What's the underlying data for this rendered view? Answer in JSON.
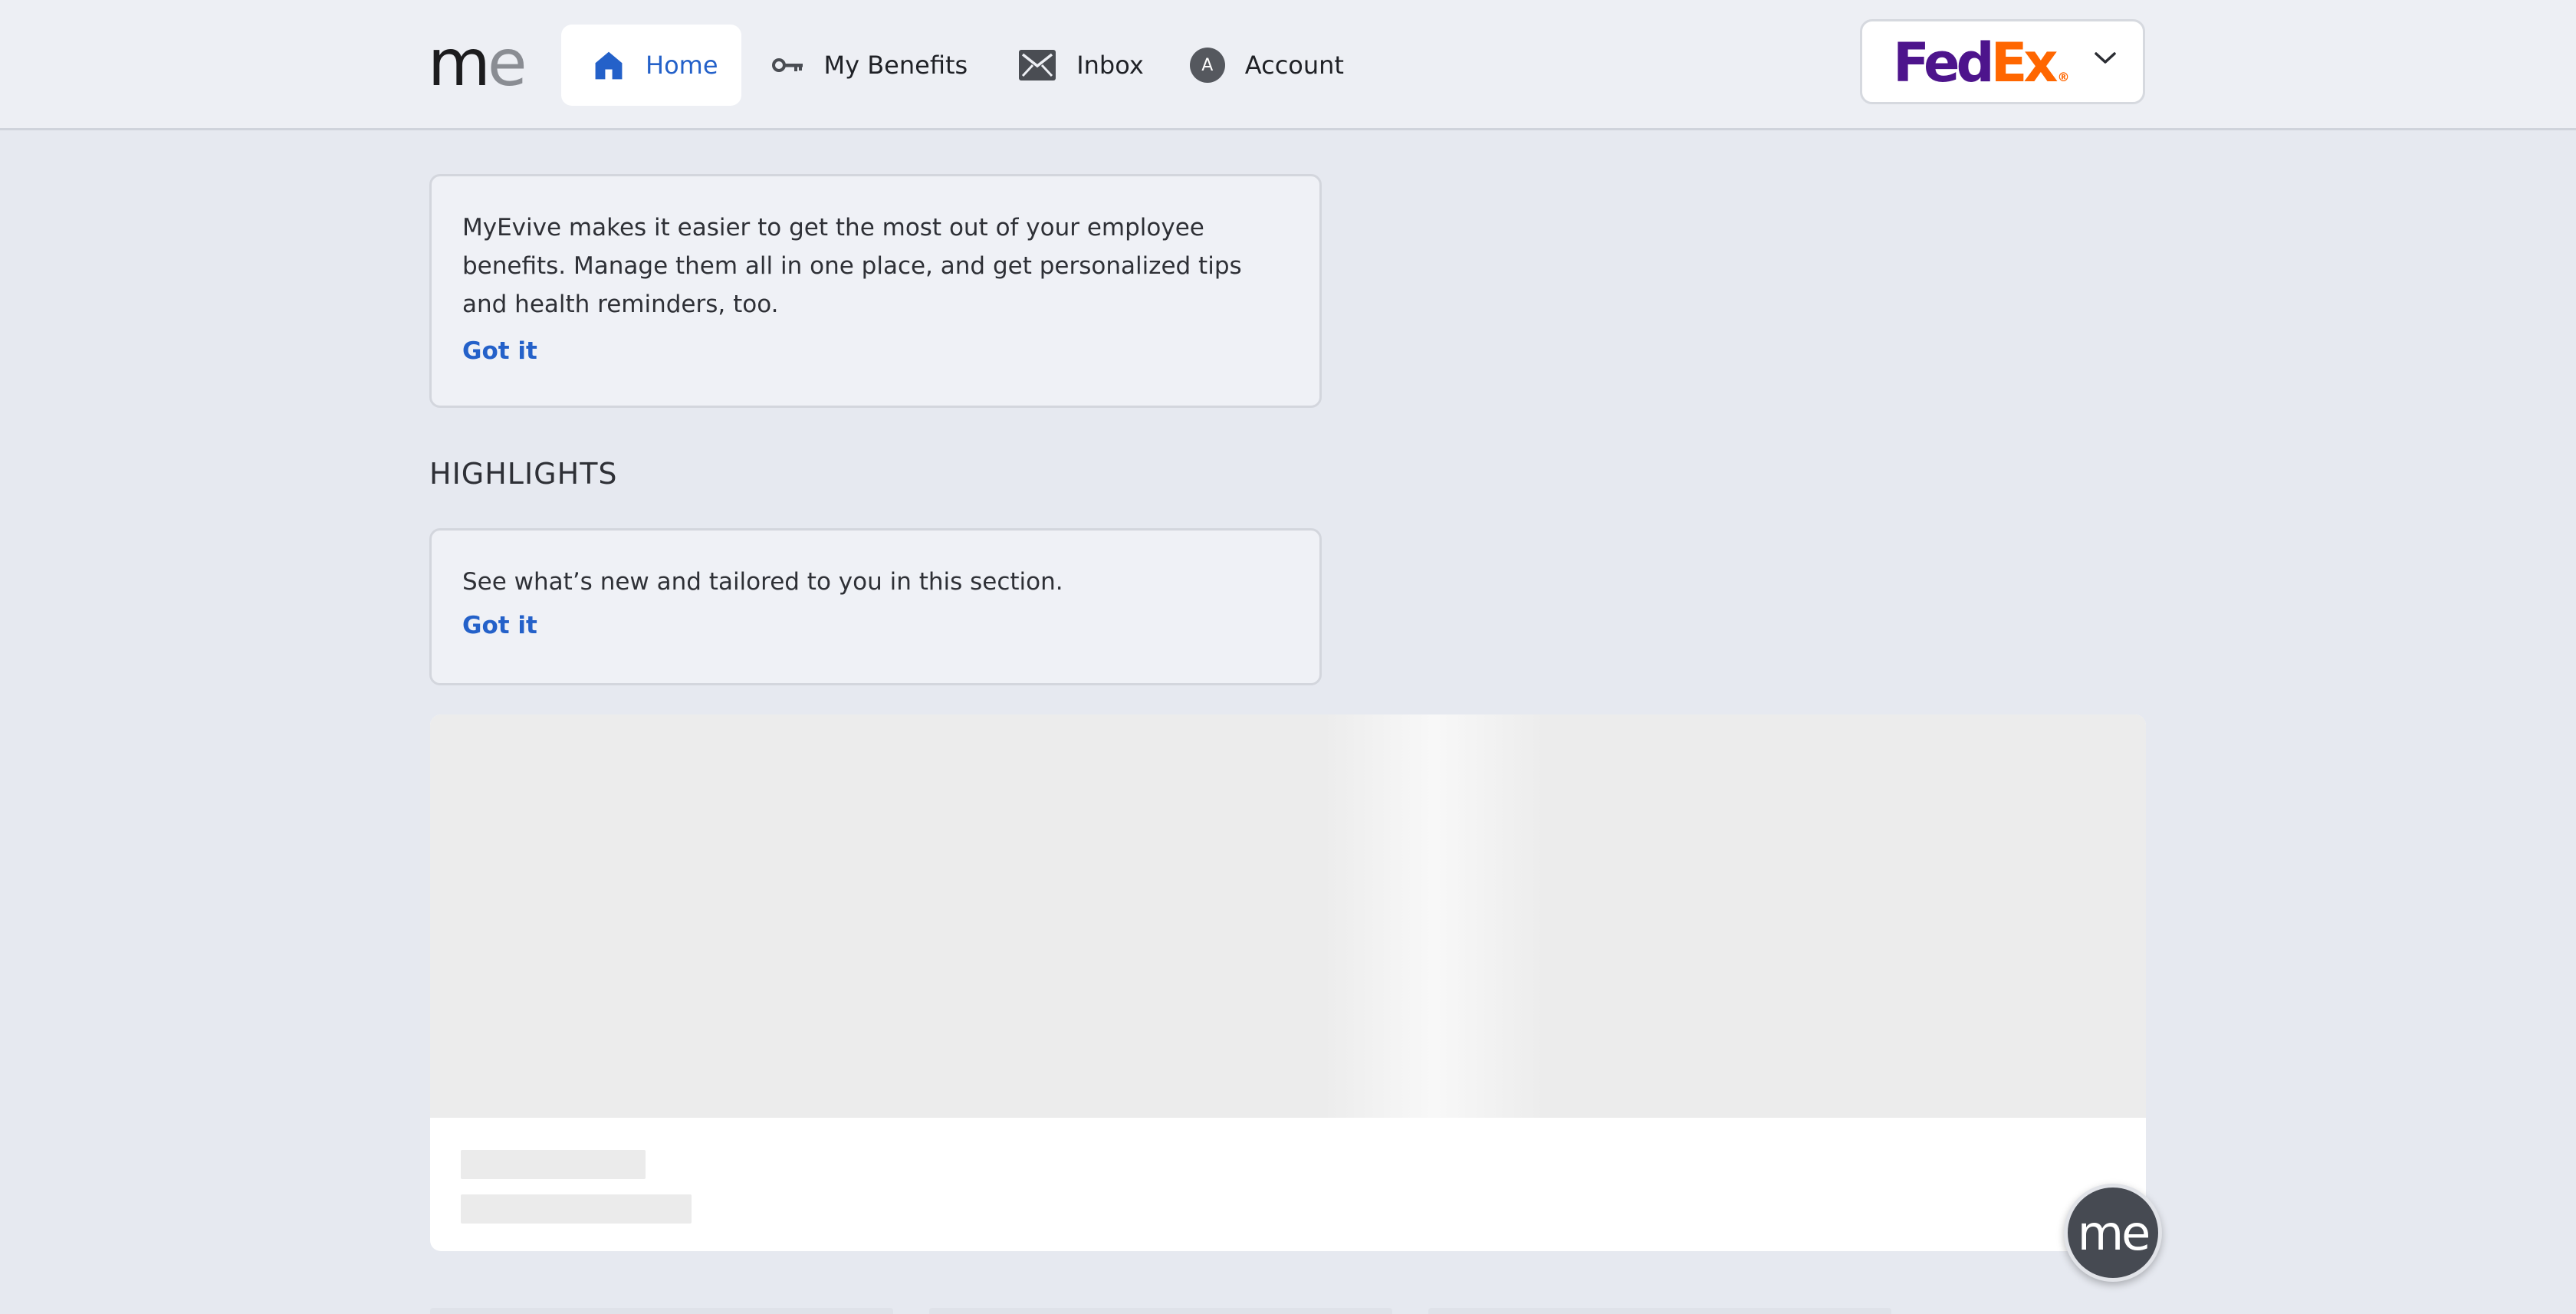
{
  "header": {
    "logo": {
      "m": "m",
      "e": "e"
    },
    "nav": [
      {
        "label": "Home",
        "icon": "home-icon",
        "active": true
      },
      {
        "label": "My Benefits",
        "icon": "key-icon"
      },
      {
        "label": "Inbox",
        "icon": "mail-icon"
      },
      {
        "label": "Account",
        "icon": "avatar-icon",
        "avatar_letter": "A"
      }
    ],
    "employer": {
      "fed": "Fed",
      "ex": "Ex",
      "reg": "®"
    }
  },
  "intro_tip": {
    "text": "MyEvive makes it easier to get the most out of your employee benefits. Manage them all in one place, and get personalized tips and health reminders, too.",
    "action": "Got it"
  },
  "highlights": {
    "title": "HIGHLIGHTS",
    "tip_text": "See what’s new and tailored to you in this section.",
    "action": "Got it"
  },
  "fab": {
    "label": "me"
  },
  "colors": {
    "accent": "#2461c9",
    "background": "#e6e9f0",
    "fedex_purple": "#4d148c",
    "fedex_orange": "#ff6600"
  }
}
